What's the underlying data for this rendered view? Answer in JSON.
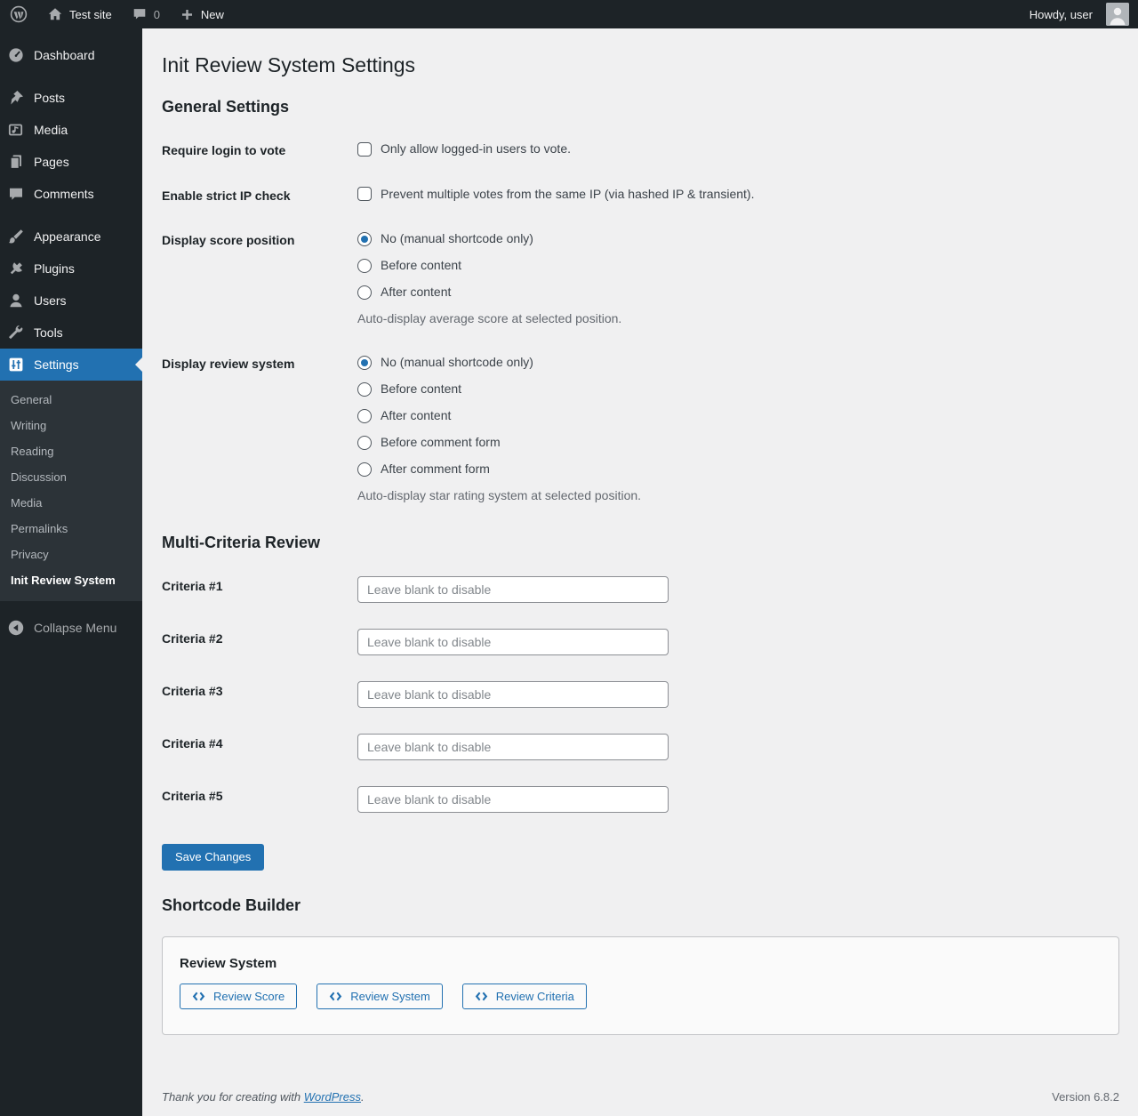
{
  "colors": {
    "accent": "#2271b1",
    "adminbar_bg": "#1d2327",
    "submenu_bg": "#2c3338",
    "content_bg": "#f0f0f1",
    "card_bg": "#fafafa"
  },
  "admin_bar": {
    "site_name": "Test site",
    "comments_count": "0",
    "new_label": "New",
    "howdy": "Howdy, user"
  },
  "sidebar": {
    "items": [
      {
        "label": "Dashboard",
        "icon": "dashboard-icon"
      },
      {
        "label": "Posts",
        "icon": "pushpin-icon"
      },
      {
        "label": "Media",
        "icon": "media-icon"
      },
      {
        "label": "Pages",
        "icon": "pages-icon"
      },
      {
        "label": "Comments",
        "icon": "comment-icon"
      },
      {
        "label": "Appearance",
        "icon": "appearance-icon"
      },
      {
        "label": "Plugins",
        "icon": "plugin-icon"
      },
      {
        "label": "Users",
        "icon": "users-icon"
      },
      {
        "label": "Tools",
        "icon": "tools-icon"
      },
      {
        "label": "Settings",
        "icon": "settings-icon",
        "active": true
      }
    ],
    "submenu": [
      {
        "label": "General"
      },
      {
        "label": "Writing"
      },
      {
        "label": "Reading"
      },
      {
        "label": "Discussion"
      },
      {
        "label": "Media"
      },
      {
        "label": "Permalinks"
      },
      {
        "label": "Privacy"
      },
      {
        "label": "Init Review System",
        "current": true
      }
    ],
    "collapse_label": "Collapse Menu"
  },
  "page": {
    "title": "Init Review System Settings",
    "general": {
      "heading": "General Settings",
      "require_login": {
        "label": "Require login to vote",
        "checkbox_label": "Only allow logged-in users to vote.",
        "checked": false
      },
      "strict_ip": {
        "label": "Enable strict IP check",
        "checkbox_label": "Prevent multiple votes from the same IP (via hashed IP & transient).",
        "checked": false
      },
      "score_position": {
        "label": "Display score position",
        "options": [
          "No (manual shortcode only)",
          "Before content",
          "After content"
        ],
        "selected_index": 0,
        "description": "Auto-display average score at selected position."
      },
      "review_system_position": {
        "label": "Display review system",
        "options": [
          "No (manual shortcode only)",
          "Before content",
          "After content",
          "Before comment form",
          "After comment form"
        ],
        "selected_index": 0,
        "description": "Auto-display star rating system at selected position."
      }
    },
    "multi_criteria": {
      "heading": "Multi-Criteria Review",
      "placeholder": "Leave blank to disable",
      "fields": [
        {
          "label": "Criteria #1",
          "value": ""
        },
        {
          "label": "Criteria #2",
          "value": ""
        },
        {
          "label": "Criteria #3",
          "value": ""
        },
        {
          "label": "Criteria #4",
          "value": ""
        },
        {
          "label": "Criteria #5",
          "value": ""
        }
      ]
    },
    "save_label": "Save Changes",
    "shortcode_builder": {
      "heading": "Shortcode Builder",
      "card_title": "Review System",
      "buttons": [
        {
          "label": "Review Score",
          "icon": "code-icon"
        },
        {
          "label": "Review System",
          "icon": "code-icon"
        },
        {
          "label": "Review Criteria",
          "icon": "code-icon"
        }
      ]
    }
  },
  "footer": {
    "thanks_prefix": "Thank you for creating with ",
    "link_label": "WordPress",
    "suffix": ".",
    "version": "Version 6.8.2"
  }
}
